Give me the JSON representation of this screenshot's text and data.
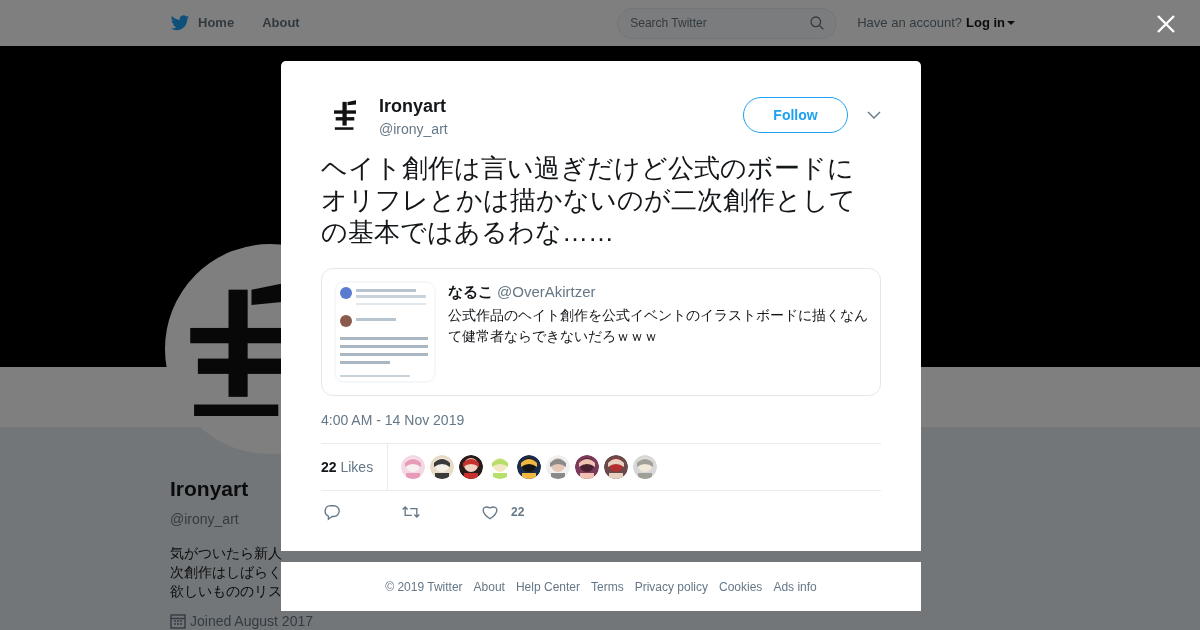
{
  "header": {
    "nav": [
      "Home",
      "About"
    ],
    "search": {
      "placeholder": "Search Twitter"
    },
    "account_prompt": "Have an account?",
    "login": "Log in"
  },
  "profile": {
    "name": "Ironyart",
    "handle": "@irony_art",
    "bio": [
      "気がついたら新人",
      "次創作はしばらく",
      "欲しいもののリス"
    ],
    "joined": "Joined August 2017"
  },
  "tweet": {
    "author": {
      "name": "Ironyart",
      "handle": "@irony_art"
    },
    "follow": "Follow",
    "text": "ヘイト創作は言い過ぎだけど公式のボードにオリフレとかは描かないのが二次創作としての基本ではあるわな……",
    "quote": {
      "name": "なるこ",
      "handle": "@OverAkirtzer",
      "text": "公式作品のヘイト創作を公式イベントのイラストボードに描くなんて健常者ならできないだろｗｗｗ"
    },
    "timestamp": "4:00 AM - 14 Nov 2019",
    "likes": {
      "count": "22",
      "label": "Likes"
    },
    "like_count": "22"
  },
  "footer": [
    "© 2019 Twitter",
    "About",
    "Help Center",
    "Terms",
    "Privacy policy",
    "Cookies",
    "Ads info"
  ]
}
